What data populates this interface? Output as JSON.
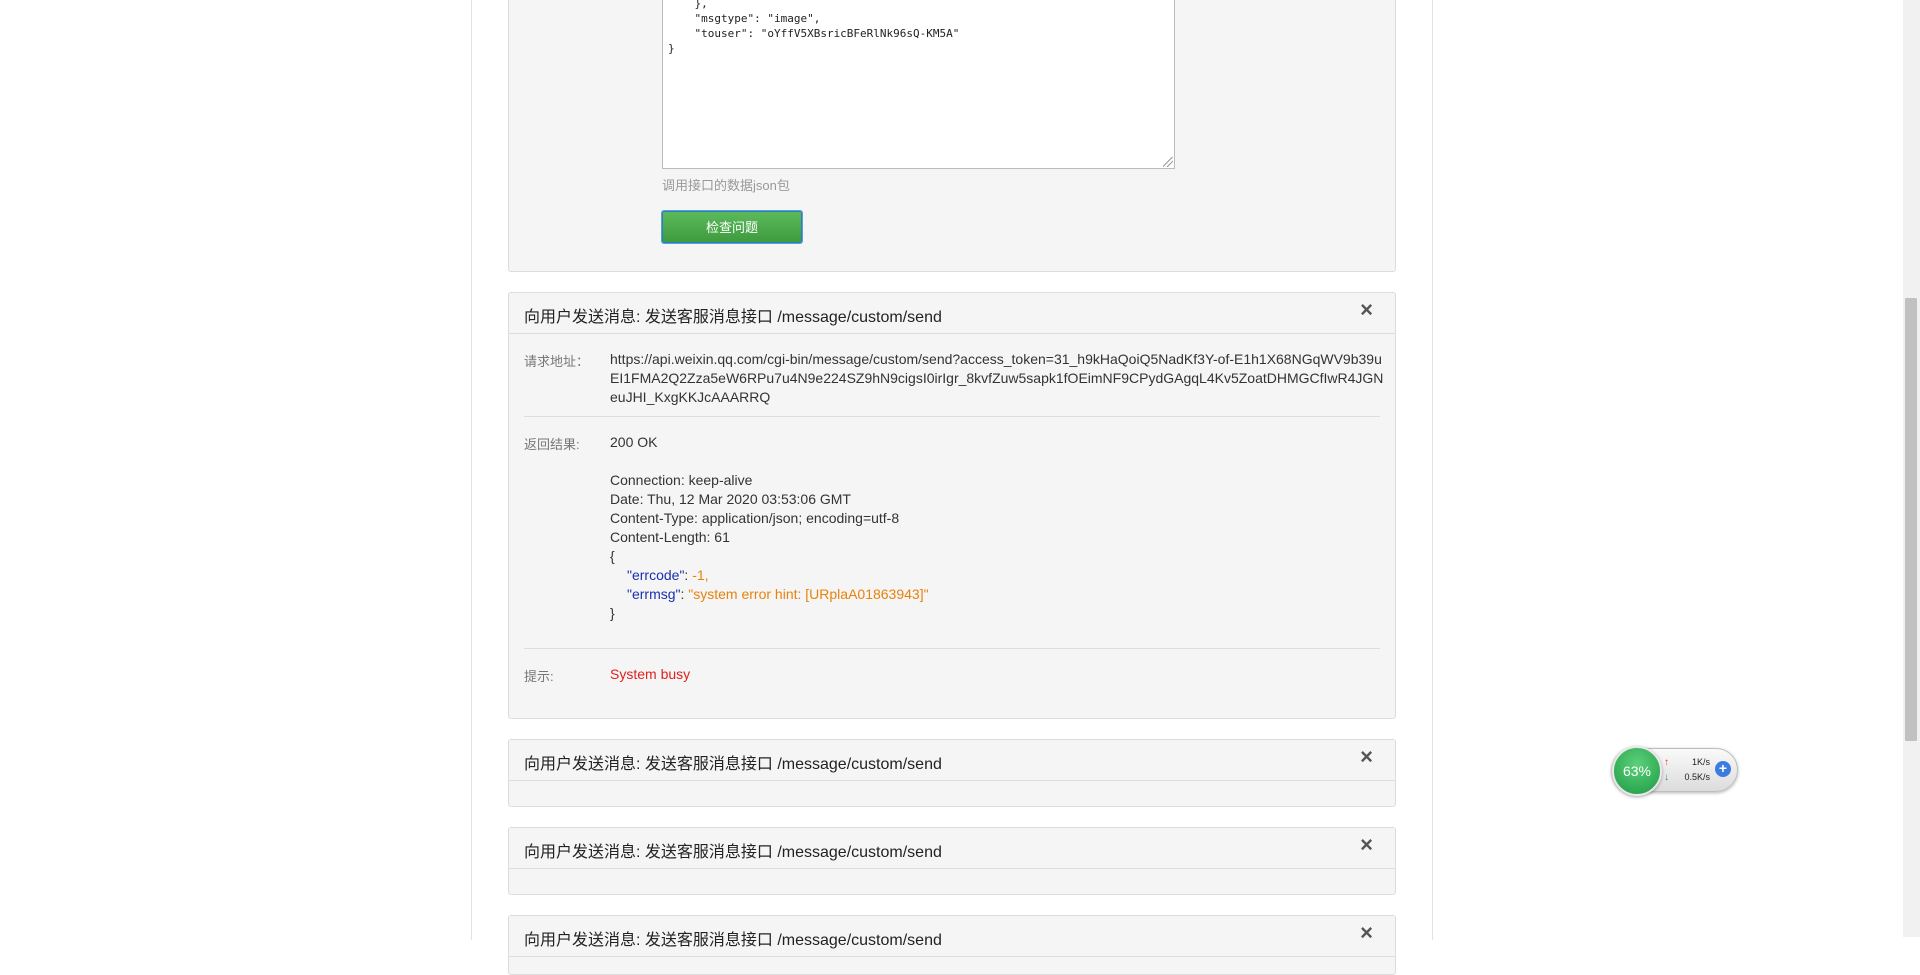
{
  "form": {
    "json_lines": [
      "    },",
      "    \"msgtype\": \"image\",",
      "    \"touser\": \"oYffV5XBsricBFeRlNk96sQ-KM5A\"",
      "}"
    ],
    "help_text": "调用接口的数据json包",
    "submit_label": "检查问题"
  },
  "requests": [
    {
      "title": "向用户发送消息: 发送客服消息接口 /message/custom/send",
      "close_icon": "×",
      "url_label": "请求地址：",
      "url": "https://api.weixin.qq.com/cgi-bin/message/custom/send?access_token=31_h9kHaQoiQ5NadKf3Y-of-E1h1X68NGqWV9b39uEI1FMA2Q2Zza5eW6RPu7u4N9e224SZ9hN9cigsI0irIgr_8kvfZuw5sapk1fOEimNF9CPydGAgqL4Kv5ZoatDHMGCfIwR4JGNeuJHI_KxgKKJcAAARRQ",
      "result_label": "返回结果:",
      "status": "200 OK",
      "headers": [
        "Connection: keep-alive",
        "Date: Thu, 12 Mar 2020 03:53:06 GMT",
        "Content-Type: application/json; encoding=utf-8",
        "Content-Length: 61"
      ],
      "body_open": "{",
      "errcode_key": "\"errcode\"",
      "errcode_val": "-1,",
      "errmsg_key": "\"errmsg\"",
      "errmsg_val": "\"system error hint: [URplaA01863943]\"",
      "body_close": "}",
      "hint_label": "提示:",
      "hint": "System busy"
    },
    {
      "title": "向用户发送消息: 发送客服消息接口 /message/custom/send",
      "close_icon": "×"
    },
    {
      "title": "向用户发送消息: 发送客服消息接口 /message/custom/send",
      "close_icon": "×"
    },
    {
      "title": "向用户发送消息: 发送客服消息接口 /message/custom/send",
      "close_icon": "×"
    }
  ],
  "net_widget": {
    "percent": "63%",
    "upload": "1K/s",
    "download": "0.5K/s",
    "up_arrow": "↑",
    "down_arrow": "↓",
    "plus": "+"
  },
  "colors": {
    "button": "#4cae4c",
    "json_key": "#1a2fb0",
    "json_value": "#e8820c",
    "hint": "#e02020"
  }
}
